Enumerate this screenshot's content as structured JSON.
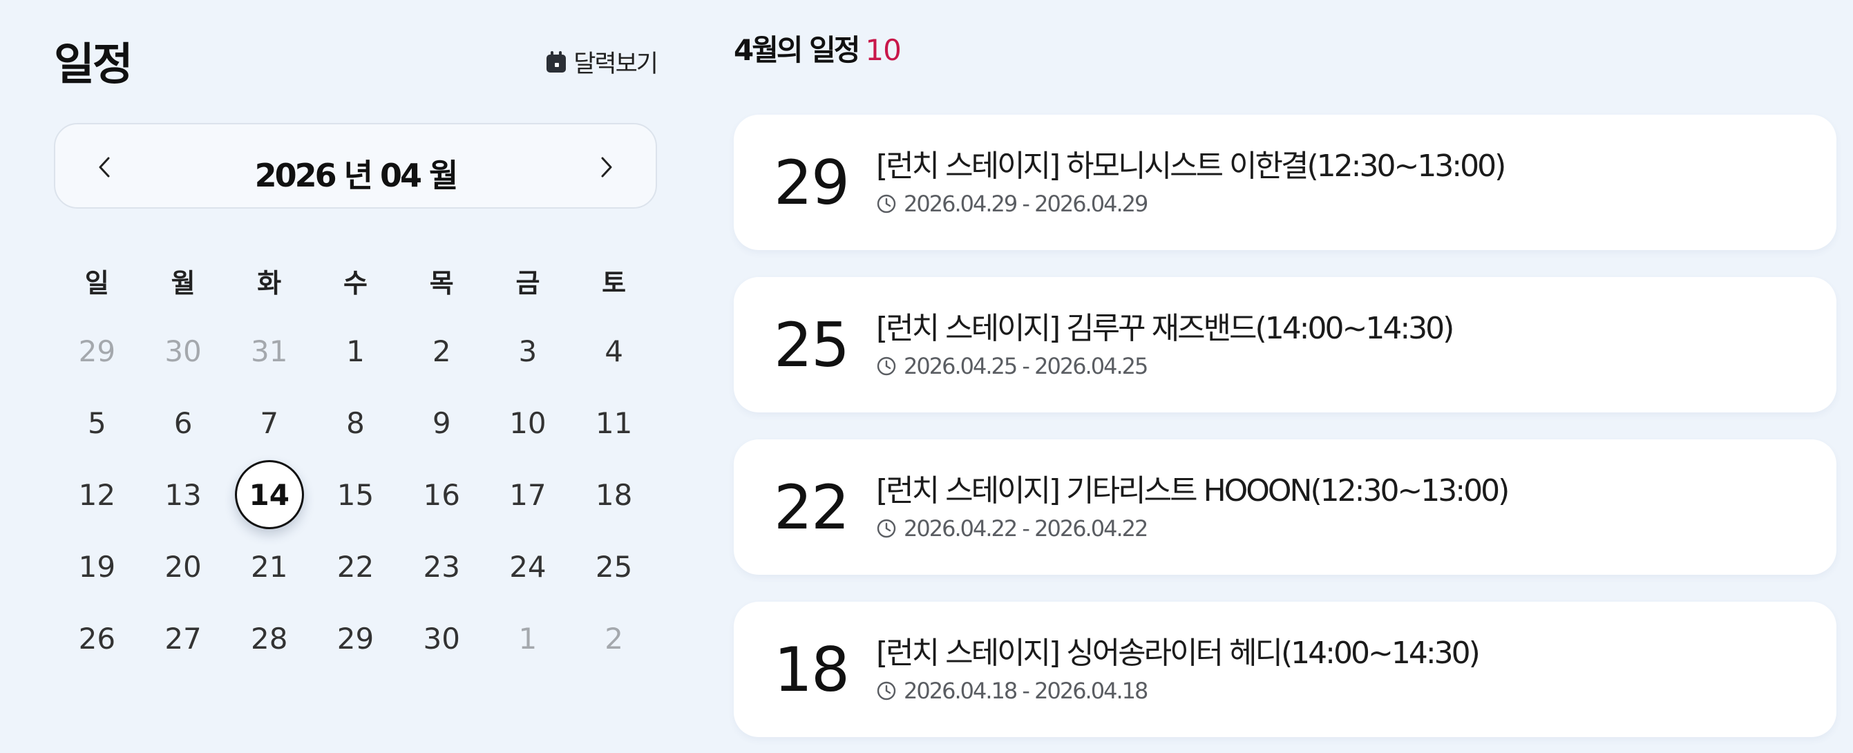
{
  "sidebar": {
    "title": "일정",
    "calendar_view_label": "달력보기",
    "icons": {
      "calendar_view": "calendar-icon",
      "prev": "chevron-left-icon",
      "next": "chevron-right-icon"
    }
  },
  "calendar": {
    "month_label": "2026 년 04 월",
    "weekdays": [
      "일",
      "월",
      "화",
      "수",
      "목",
      "금",
      "토"
    ],
    "selected_day": "14",
    "weeks": [
      [
        {
          "d": "29",
          "m": true
        },
        {
          "d": "30",
          "m": true
        },
        {
          "d": "31",
          "m": true
        },
        {
          "d": "1"
        },
        {
          "d": "2"
        },
        {
          "d": "3"
        },
        {
          "d": "4"
        }
      ],
      [
        {
          "d": "5"
        },
        {
          "d": "6"
        },
        {
          "d": "7"
        },
        {
          "d": "8"
        },
        {
          "d": "9"
        },
        {
          "d": "10"
        },
        {
          "d": "11"
        }
      ],
      [
        {
          "d": "12"
        },
        {
          "d": "13"
        },
        {
          "d": "14",
          "t": true
        },
        {
          "d": "15"
        },
        {
          "d": "16"
        },
        {
          "d": "17"
        },
        {
          "d": "18"
        }
      ],
      [
        {
          "d": "19"
        },
        {
          "d": "20"
        },
        {
          "d": "21"
        },
        {
          "d": "22"
        },
        {
          "d": "23"
        },
        {
          "d": "24"
        },
        {
          "d": "25"
        }
      ],
      [
        {
          "d": "26"
        },
        {
          "d": "27"
        },
        {
          "d": "28"
        },
        {
          "d": "29"
        },
        {
          "d": "30"
        },
        {
          "d": "1",
          "m": true
        },
        {
          "d": "2",
          "m": true
        }
      ]
    ]
  },
  "events": {
    "heading": "4월의 일정",
    "count": "10",
    "items": [
      {
        "day": "29",
        "title": "[런치 스테이지] 하모니시스트 이한결(12:30~13:00)",
        "date_range": "2026.04.29 - 2026.04.29"
      },
      {
        "day": "25",
        "title": "[런치 스테이지] 김루꾸 재즈밴드(14:00~14:30)",
        "date_range": "2026.04.25 - 2026.04.25"
      },
      {
        "day": "22",
        "title": "[런치 스테이지] 기타리스트 HOOON(12:30~13:00)",
        "date_range": "2026.04.22 - 2026.04.22"
      },
      {
        "day": "18",
        "title": "[런치 스테이지] 싱어송라이터 헤디(14:00~14:30)",
        "date_range": "2026.04.18 - 2026.04.18"
      }
    ],
    "icons": {
      "date": "clock-icon"
    }
  },
  "colors": {
    "background": "#eef4fb",
    "accent": "#c8174a",
    "card": "#ffffff",
    "muted_day": "#a4a8ad"
  }
}
